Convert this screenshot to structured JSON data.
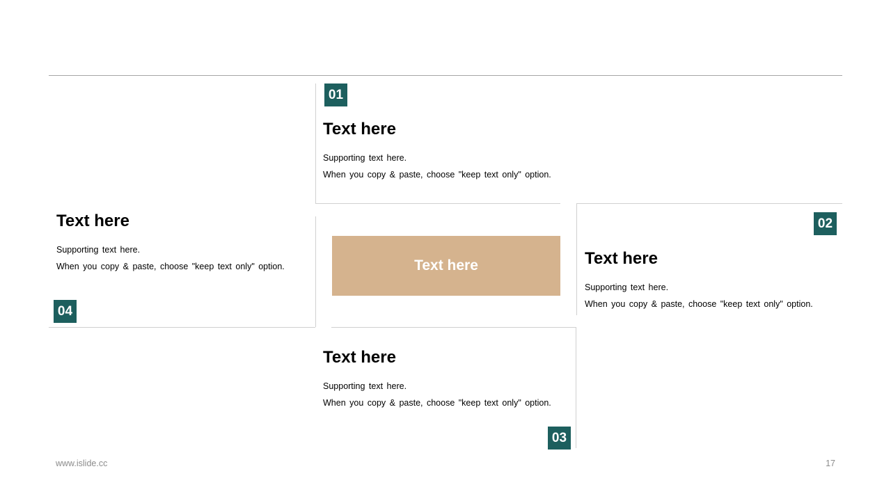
{
  "blocks": [
    {
      "number": "01",
      "title": "Text here",
      "line1": "Supporting text here.",
      "line2": "When you copy & paste, choose \"keep text only\" option."
    },
    {
      "number": "02",
      "title": "Text here",
      "line1": "Supporting text here.",
      "line2": "When you copy & paste, choose \"keep text only\" option."
    },
    {
      "number": "03",
      "title": "Text here",
      "line1": "Supporting text here.",
      "line2": "When you copy & paste, choose \"keep text only\" option."
    },
    {
      "number": "04",
      "title": "Text here",
      "line1": "Supporting text here.",
      "line2": "When you copy & paste, choose \"keep text only\" option."
    }
  ],
  "center": {
    "label": "Text here"
  },
  "footer": {
    "url": "www.islide.cc",
    "page": "17"
  },
  "colors": {
    "badge": "#1d5f5e",
    "center_box": "#d5b38e",
    "rule": "#a6a6a6",
    "frame": "#d0d0d0",
    "footer_text": "#8c8c8c"
  }
}
